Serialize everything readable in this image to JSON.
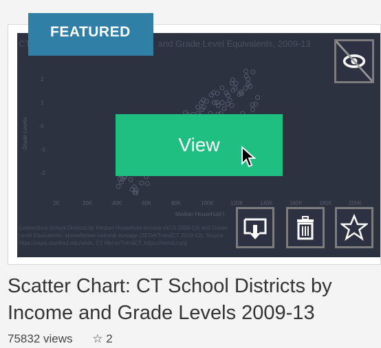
{
  "badge": "FEATURED",
  "thumbnail": {
    "title_fragment": "CT",
    "title_fragment_right": "and Grade Level Equivalents, 2009-13",
    "y_axis_label": "Grade Levels",
    "x_axis_label": "Median Household I",
    "x_ticks": [
      "2K",
      "20K",
      "40K",
      "60K",
      "80K",
      "100K",
      "120K",
      "140K",
      "160K",
      "180K",
      "200K"
    ],
    "y_ticks": [
      "2",
      "1",
      "0",
      "-1",
      "-2"
    ],
    "caption": "Connecticut School Districts by Median Household Income (ACS 2009-13) and Grade Level Equivalents, above/below national average (SEDA/TrendCT 2009-13). Source: https://cepa.stanford.edu/seda, CT Mirror/TrendCT, https://trendct.org"
  },
  "view_label": "View",
  "card": {
    "title": "Scatter Chart: CT School Districts by Income and Grade Levels 2009-13",
    "views": "75832 views",
    "stars": "☆ 2"
  },
  "icons": {
    "hide": "eye-slash-icon",
    "download": "download-icon",
    "delete": "trash-icon",
    "favorite": "star-icon"
  }
}
